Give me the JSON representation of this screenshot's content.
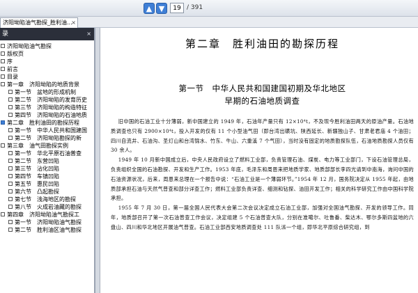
{
  "toolbar": {
    "up_icon": "arrow-up-icon",
    "down_icon": "arrow-down-icon",
    "current_page": "19",
    "total_pages": "/ 391"
  },
  "tab": {
    "label": "济阳坳陷油气勘探_胜利油...",
    "close": "×"
  },
  "sidebar": {
    "title": "录",
    "close": "×",
    "items": [
      {
        "label": "济阳坳陷油气勘探",
        "level": 0,
        "expanded": false
      },
      {
        "label": "版权页",
        "level": 0,
        "expanded": false
      },
      {
        "label": "序",
        "level": 0,
        "expanded": false
      },
      {
        "label": "前言",
        "level": 0,
        "expanded": false
      },
      {
        "label": "目录",
        "level": 0,
        "expanded": false
      },
      {
        "label": "第一章　济阳坳陷的地质背景",
        "level": 0,
        "expanded": false
      },
      {
        "label": "第一节　盆地的形成机制",
        "level": 1,
        "expanded": false
      },
      {
        "label": "第二节　济阳坳陷的发育历史",
        "level": 1,
        "expanded": false
      },
      {
        "label": "第三节　济阳坳陷的构造特征",
        "level": 1,
        "expanded": false
      },
      {
        "label": "第四节　济阳坳陷的石油地质",
        "level": 1,
        "expanded": false
      },
      {
        "label": "第二章　胜利油田的勘探历程",
        "level": 0,
        "expanded": true
      },
      {
        "label": "第一节　中华人民共和国建国",
        "level": 1,
        "expanded": false
      },
      {
        "label": "第二节　济阳坳陷勘探的新",
        "level": 1,
        "expanded": false
      },
      {
        "label": "第三章　油气田勘探实例",
        "level": 0,
        "expanded": false
      },
      {
        "label": "第一节　华北平原石油普查",
        "level": 1,
        "expanded": false
      },
      {
        "label": "第二节　东营凹陷",
        "level": 1,
        "expanded": false
      },
      {
        "label": "第三节　沾化凹陷",
        "level": 1,
        "expanded": false
      },
      {
        "label": "第四节　车镇凹陷",
        "level": 1,
        "expanded": false
      },
      {
        "label": "第五节　惠民凹陷",
        "level": 1,
        "expanded": false
      },
      {
        "label": "第六节　凸起勘探",
        "level": 1,
        "expanded": false
      },
      {
        "label": "第七节　浅海地区的勘探",
        "level": 1,
        "expanded": false
      },
      {
        "label": "第八节　火成岩油藏的勘探",
        "level": 1,
        "expanded": false
      },
      {
        "label": "第四章　济阳坳陷油气勘探工",
        "level": 0,
        "expanded": false
      },
      {
        "label": "第一节　济阳坳陷油气勘探",
        "level": 1,
        "expanded": false
      },
      {
        "label": "第二节　胜利油区油气勘探",
        "level": 1,
        "expanded": false
      }
    ]
  },
  "document": {
    "chapter_title": "第二章　胜利油田的勘探历程",
    "section_title_line1": "第一节　中华人民共和国建国初期及华北地区",
    "section_title_line2": "早期的石油地质调查",
    "paragraphs": [
      "旧中国的石油工业十分薄弱，新中国建立的 1949 年，石油年产量只有 12×10⁴t，不及现今胜利油田两天的原油产量。石油地质调查也只有 2900×10⁴t，投入开发的仅有 11 个小型油气田（即台湾出磺坑、陕西延长、新疆独山子、甘肃老君庙 4 个油田；四川自流井、石油沟、圣灯山和台湾锦水、竹东、牛山、六重溪 7 个气田），当时没有固定的地质勘探队伍，石油地质勘探人员仅有 30 余人。",
      "1949 年 10 月新中国成立后，中央人民政府设立了燃料工业部，负责管理石油、煤炭、电力等工业部门，下设石油管理总局，负责组织全国的石油勘探、开发和生产工作。1953 年底，毛泽东和周恩来把地质学家、地质部部长李四光请到中南海，询问中国的石油资源状况，后来，周恩来总理在一个报告中说：“石油工业是一个薄弱环节。”1954 年 12 月，国务院决定从 1955 年起，由地质部承担石油与天然气普查和部分详查工作；燃料工业部负责详查、细测和钻探、油田开发工作；相关的科学研究工作由中国科学院承担。",
      "1955 年 7 月 30 日，第一届全国人民代表大会第二次会议决定成立石油工业部，加强对全国油气勘探、开发的领导工作。同年，地质部召开了第一次石油普查工作会议，决定组建 5 个石油普查大队，分别在准噶尔、吐鲁番、柴达木、鄂尔多斯四盆地的六盘山、四川和华北地区开展油气普查。石油工业部西安地质调查处 111 队派一个组，即华北平原综合研究组，到"
    ]
  }
}
